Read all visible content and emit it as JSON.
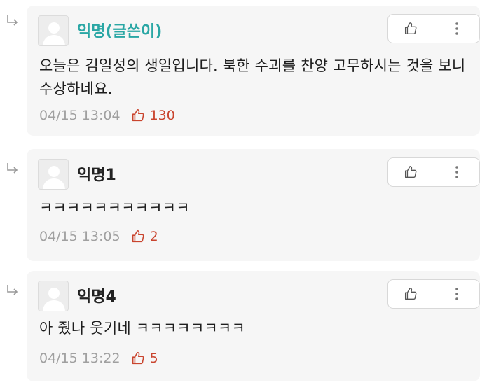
{
  "comments": [
    {
      "author": "익명(글쓴이)",
      "is_author": true,
      "text": "오늘은 김일성의 생일입니다. 북한 수괴를 찬양 고무하시는 것을 보니 수상하네요.",
      "time": "04/15 13:04",
      "likes": "130"
    },
    {
      "author": "익명1",
      "is_author": false,
      "text": "ㅋㅋㅋㅋㅋㅋㅋㅋㅋㅋㅋ",
      "time": "04/15 13:05",
      "likes": "2"
    },
    {
      "author": "익명4",
      "is_author": false,
      "text": "아 줬나 웃기네 ㅋㅋㅋㅋㅋㅋㅋㅋ",
      "time": "04/15 13:22",
      "likes": "5"
    }
  ],
  "icons": {
    "reply": "reply-arrow-icon",
    "like_button": "thumbs-up-icon",
    "more_button": "more-vertical-icon",
    "like_count": "thumbs-up-icon"
  },
  "colors": {
    "author_nick": "#2aa7a5",
    "like_count": "#c9442e",
    "card_bg": "#f6f6f6"
  }
}
